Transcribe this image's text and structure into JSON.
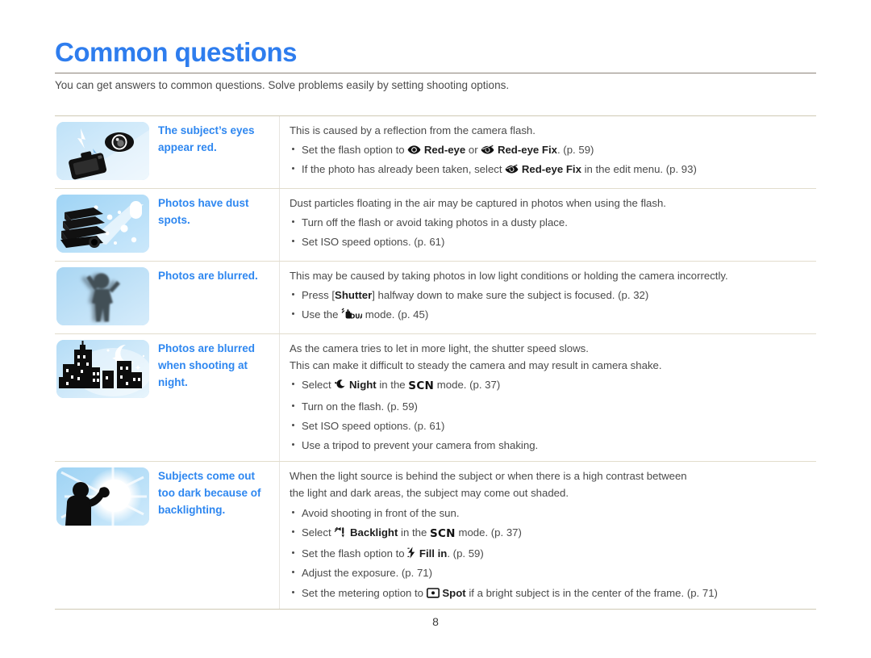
{
  "header": {
    "title": "Common questions",
    "intro": "You can get answers to common questions. Solve problems easily by setting shooting options.",
    "accent_color": "#2e7dee",
    "rule_color": "#8b8278"
  },
  "footer": {
    "page_number": "8"
  },
  "table": {
    "rows": [
      {
        "thumb_name": "red-eye-illustration",
        "thumb_alt": "Camera with flash and a large eye",
        "label": "The subject’s eyes appear red.",
        "lead": [
          "This is caused by a reflection from the camera flash."
        ],
        "bullets": [
          {
            "segments": [
              {
                "t": "Set the flash option to ",
                "s": "normal"
              },
              {
                "t": "redeye-icon",
                "s": "icon"
              },
              {
                "t": "Red-eye",
                "s": "bold"
              },
              {
                "t": " or ",
                "s": "normal"
              },
              {
                "t": "redeye-fix-icon",
                "s": "icon"
              },
              {
                "t": "Red-eye Fix",
                "s": "bold"
              },
              {
                "t": ". (p. 59)",
                "s": "normal"
              }
            ]
          },
          {
            "segments": [
              {
                "t": "If the photo has already been taken, select ",
                "s": "normal"
              },
              {
                "t": "redeye-fix-icon",
                "s": "icon"
              },
              {
                "t": "Red-eye Fix",
                "s": "bold"
              },
              {
                "t": " in the edit menu. (p. 93)",
                "s": "normal"
              }
            ]
          }
        ]
      },
      {
        "thumb_name": "dust-spots-illustration",
        "thumb_alt": "Camera with flash beam and floating dust particles",
        "label": "Photos have dust spots.",
        "lead": [
          "Dust particles floating in the air may be captured in photos when using the flash."
        ],
        "bullets": [
          {
            "segments": [
              {
                "t": "Turn off the flash or avoid taking photos in a dusty place.",
                "s": "normal"
              }
            ]
          },
          {
            "segments": [
              {
                "t": "Set ISO speed options. (p. 61)",
                "s": "normal"
              }
            ]
          }
        ]
      },
      {
        "thumb_name": "blurred-photo-illustration",
        "thumb_alt": "Blurred silhouette of a person",
        "label": "Photos are blurred.",
        "lead": [
          "This may be caused by taking photos in low light conditions or holding the camera incorrectly."
        ],
        "bullets": [
          {
            "segments": [
              {
                "t": "Press [",
                "s": "normal"
              },
              {
                "t": "Shutter",
                "s": "bold"
              },
              {
                "t": "] halfway down to make sure the subject is focused. (p. 32)",
                "s": "normal"
              }
            ]
          },
          {
            "segments": [
              {
                "t": "Use the ",
                "s": "normal"
              },
              {
                "t": "dual-is-icon",
                "s": "icon"
              },
              {
                "t": " mode. (p. 45)",
                "s": "normal"
              }
            ]
          }
        ]
      },
      {
        "thumb_name": "night-city-illustration",
        "thumb_alt": "Night cityscape with crescent moon and stars",
        "label": "Photos are blurred when shooting at night.",
        "lead": [
          "As the camera tries to let in more light, the shutter speed slows.",
          "This can make it difficult to steady the camera and may result in camera shake."
        ],
        "bullets": [
          {
            "segments": [
              {
                "t": "Select ",
                "s": "normal"
              },
              {
                "t": "night-mode-icon",
                "s": "icon"
              },
              {
                "t": "Night",
                "s": "bold"
              },
              {
                "t": " in the ",
                "s": "normal"
              },
              {
                "t": "SCN",
                "s": "scn"
              },
              {
                "t": " mode. (p. 37)",
                "s": "normal"
              }
            ]
          },
          {
            "segments": [
              {
                "t": "Turn on the flash. (p. 59)",
                "s": "normal"
              }
            ]
          },
          {
            "segments": [
              {
                "t": "Set ISO speed options. (p. 61)",
                "s": "normal"
              }
            ]
          },
          {
            "segments": [
              {
                "t": "Use a tripod to prevent your camera from shaking.",
                "s": "normal"
              }
            ]
          }
        ]
      },
      {
        "thumb_name": "backlighting-illustration",
        "thumb_alt": "Backlit silhouette of a person in front of the sun",
        "label": "Subjects come out too dark because of backlighting.",
        "lead": [
          "When the light source is behind the subject or when there is a high contrast between",
          "the light and dark areas, the subject may come out shaded."
        ],
        "bullets": [
          {
            "segments": [
              {
                "t": "Avoid shooting in front of the sun.",
                "s": "normal"
              }
            ]
          },
          {
            "segments": [
              {
                "t": "Select ",
                "s": "normal"
              },
              {
                "t": "backlight-icon",
                "s": "icon"
              },
              {
                "t": "Backlight",
                "s": "bold"
              },
              {
                "t": " in the ",
                "s": "normal"
              },
              {
                "t": "SCN",
                "s": "scn"
              },
              {
                "t": " mode. (p. 37)",
                "s": "normal"
              }
            ]
          },
          {
            "segments": [
              {
                "t": "Set the flash option to ",
                "s": "normal"
              },
              {
                "t": "fill-in-flash-icon",
                "s": "icon"
              },
              {
                "t": "Fill in",
                "s": "bold"
              },
              {
                "t": ". (p. 59)",
                "s": "normal"
              }
            ]
          },
          {
            "segments": [
              {
                "t": "Adjust the exposure. (p. 71)",
                "s": "normal"
              }
            ]
          },
          {
            "segments": [
              {
                "t": "Set the metering option to ",
                "s": "normal"
              },
              {
                "t": "spot-metering-icon",
                "s": "icon"
              },
              {
                "t": "Spot",
                "s": "bold"
              },
              {
                "t": " if a bright subject is in the center of the frame. (p. 71)",
                "s": "normal"
              }
            ]
          }
        ]
      }
    ]
  }
}
